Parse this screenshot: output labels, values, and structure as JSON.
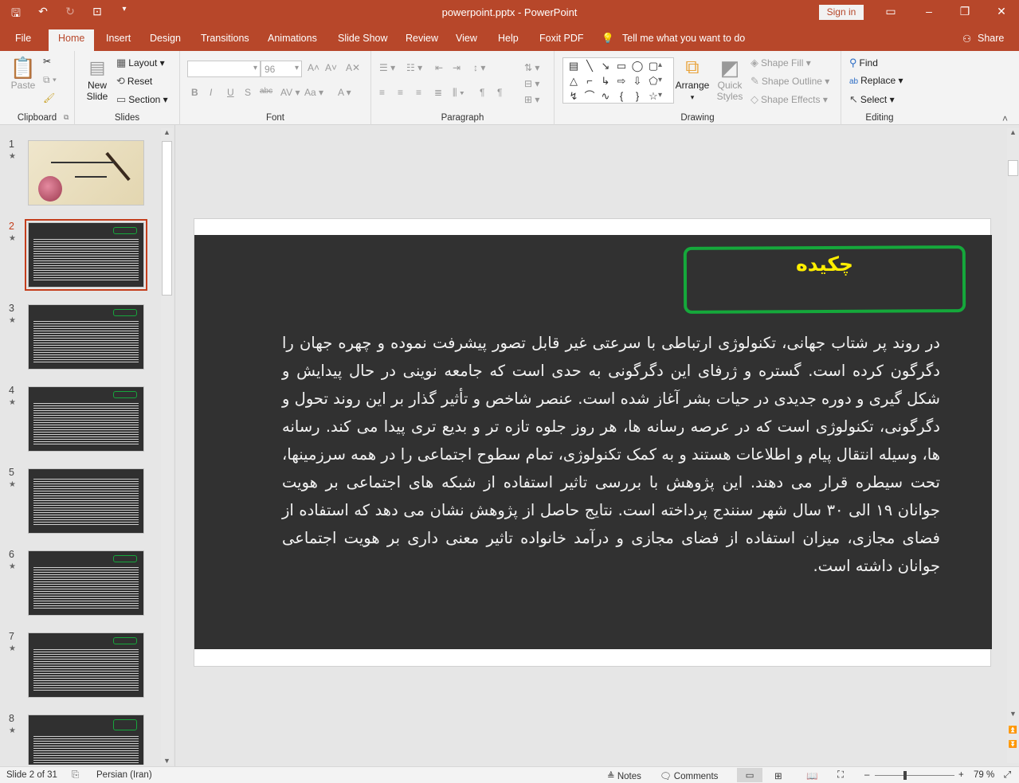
{
  "window": {
    "title": "powerpoint.pptx  -  PowerPoint",
    "sign_in": "Sign in"
  },
  "tabs": [
    "File",
    "Home",
    "Insert",
    "Design",
    "Transitions",
    "Animations",
    "Slide Show",
    "Review",
    "View",
    "Help",
    "Foxit PDF"
  ],
  "tell_me": "Tell me what you want to do",
  "share": "Share",
  "ribbon": {
    "clipboard": {
      "paste": "Paste",
      "label": "Clipboard"
    },
    "slides": {
      "new_slide": "New Slide",
      "layout": "Layout",
      "reset": "Reset",
      "section": "Section",
      "label": "Slides"
    },
    "font": {
      "size": "96",
      "label": "Font"
    },
    "paragraph": {
      "label": "Paragraph"
    },
    "drawing": {
      "arrange": "Arrange",
      "quick_styles": "Quick Styles",
      "shape_fill": "Shape Fill",
      "shape_outline": "Shape Outline",
      "shape_effects": "Shape Effects",
      "label": "Drawing"
    },
    "editing": {
      "find": "Find",
      "replace": "Replace",
      "select": "Select",
      "label": "Editing"
    }
  },
  "thumbnails": [
    {
      "num": "1",
      "star": "★"
    },
    {
      "num": "2",
      "star": "★"
    },
    {
      "num": "3",
      "star": "★"
    },
    {
      "num": "4",
      "star": "★"
    },
    {
      "num": "5",
      "star": "★"
    },
    {
      "num": "6",
      "star": "★"
    },
    {
      "num": "7",
      "star": "★"
    },
    {
      "num": "8",
      "star": "★"
    }
  ],
  "selected_slide": 2,
  "slide": {
    "title": "چکیده",
    "body": "در روند پر شتاب جهانی، تکنولوژی ارتباطی با سرعتی غیر قابل تصور پیشرفت نموده و چهره جهان را دگرگون کرده است. گستره و ژرفای این دگرگونی به حدی است که جامعه نوینی در حال پیدایش و شکل گیری و دوره جدیدی در حیات بشر آغاز شده است. عنصر شاخص و تأثیر گذار بر این روند تحول و دگرگونی، تکنولوژی است که در عرصه رسانه ها، هر روز جلوه تازه تر و بدیع تری پیدا می کند. رسانه ها، وسیله انتقال پیام و اطلاعات هستند و به کمک تکنولوژی، تمام سطوح اجتماعی را در همه سرزمینها، تحت سیطره قرار می دهند. این پژوهش با بررسی تاثیر استفاده از شبکه های اجتماعی بر هویت جوانان ۱۹ الی ۳۰ سال شهر سنندج پرداخته است. نتایج حاصل از پژوهش نشان می دهد که استفاده از فضای مجازی، میزان استفاده از فضای مجازی و درآمد خانواده تاثیر معنی داری بر هویت اجتماعی جوانان داشته است."
  },
  "status": {
    "slide_of": "Slide 2 of 31",
    "language": "Persian (Iran)",
    "notes": "Notes",
    "comments": "Comments",
    "zoom": "79 %"
  },
  "colors": {
    "accent": "#b7472a",
    "slide_bg": "#313131",
    "title_yellow": "#ffee00",
    "pill_green": "#15a83b"
  }
}
